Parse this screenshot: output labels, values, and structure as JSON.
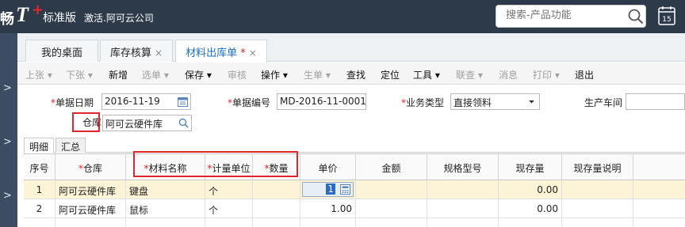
{
  "topbar": {
    "logo_pre": "畅",
    "logo_main": "T",
    "logo_plus": "+",
    "edition": "标准版",
    "company": "激活.阿可云公司",
    "search_placeholder": "搜索-产品功能",
    "calendar_day": "15"
  },
  "tabs": [
    {
      "label": "我的桌面"
    },
    {
      "label": "库存核算"
    },
    {
      "label": "材料出库单",
      "modified": "*"
    }
  ],
  "tab_close": "×",
  "toolbar": {
    "items": [
      "上张 ▾",
      "下张 ▾",
      "新增",
      "选单 ▾",
      "保存 ▾",
      "审核",
      "操作 ▾",
      "生单 ▾",
      "查找",
      "定位",
      "工具 ▾",
      "联查 ▾",
      "消息",
      "打印 ▾",
      "退出"
    ]
  },
  "form": {
    "date_label": "单据日期",
    "date_value": "2016-11-19",
    "code_label": "单据编号",
    "code_value": "MD-2016-11-0001",
    "biztype_label": "业务类型",
    "biztype_value": "直接领料",
    "workshop_label": "生产车间",
    "warehouse_label": "仓库",
    "warehouse_value": "阿可云硬件库"
  },
  "subtabs": [
    "明细",
    "汇总"
  ],
  "grid": {
    "headers": [
      "序号",
      "仓库",
      "材料名称",
      "计量单位",
      "数量",
      "单价",
      "金额",
      "规格型号",
      "现存量",
      "现存量说明"
    ],
    "rows": [
      {
        "no": "1",
        "warehouse": "阿可云硬件库",
        "material": "键盘",
        "unit": "个",
        "qty": "",
        "price": "1",
        "amount": "",
        "spec": "",
        "stock": "0.00",
        "stock_note": ""
      },
      {
        "no": "2",
        "warehouse": "阿可云硬件库",
        "material": "鼠标",
        "unit": "个",
        "qty": "",
        "price": "1.00",
        "amount": "",
        "spec": "",
        "stock": "0.00",
        "stock_note": ""
      }
    ]
  },
  "colors": {
    "topbar": "#2d3a4a",
    "active_tab_text": "#1a6fc0",
    "required": "#e8232a",
    "highlight_box": "#e0262c",
    "row_highlight": "#fdf3d6"
  },
  "icons": [
    "search-icon",
    "calendar-icon",
    "magnifier-icon",
    "chevron-right-icon",
    "dropdown-arrow-icon"
  ]
}
